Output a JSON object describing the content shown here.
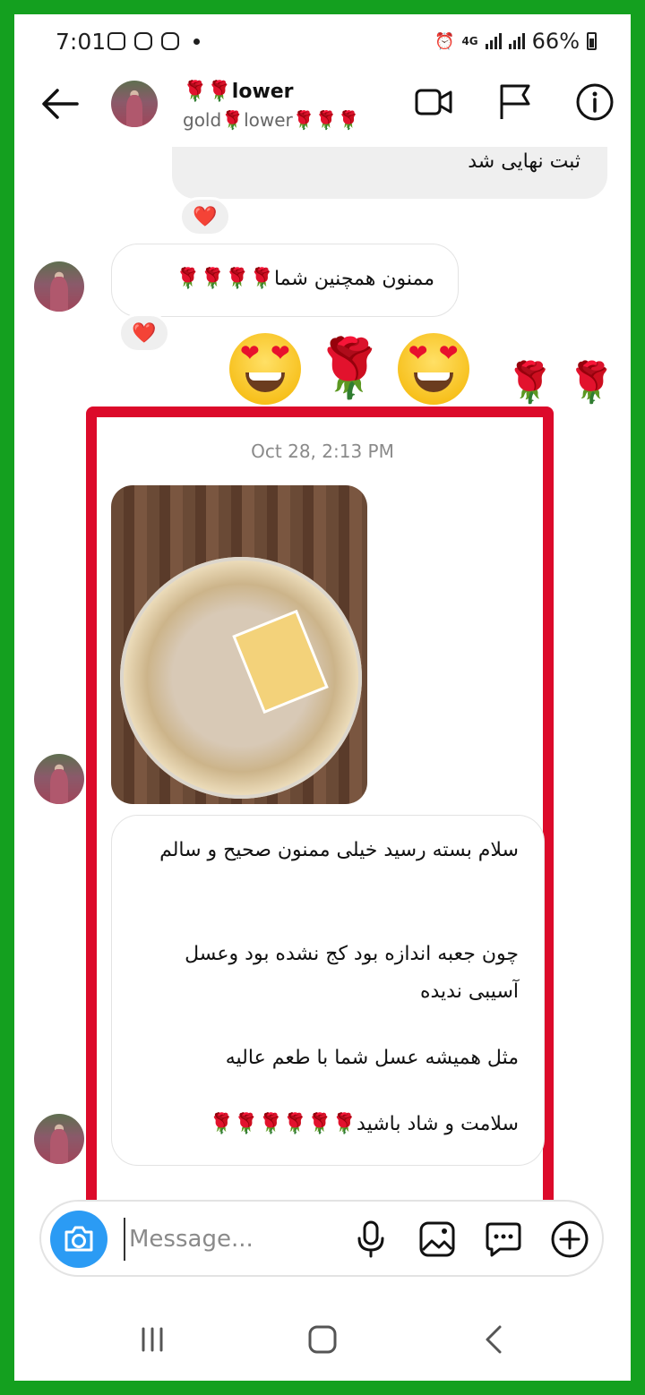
{
  "status_bar": {
    "time": "7:01",
    "network": "4G",
    "battery": "66%"
  },
  "header": {
    "name": "🌹🌹lower",
    "username": "gold🌹lower🌹🌹🌹"
  },
  "messages": [
    {
      "side": "out",
      "text": "ثبت نهایی شد",
      "reaction": "❤️"
    },
    {
      "side": "in",
      "text": "ممنون همچنین شما🌹🌹🌹🌹",
      "reaction": "❤️"
    },
    {
      "side": "in-emoji",
      "roses": "🌹 🌹"
    },
    {
      "side": "in",
      "timestamp": "Oct 28, 2:13 PM",
      "type": "photo"
    },
    {
      "side": "in",
      "paragraphs": [
        "سلام  بسته رسید خیلی ممنون صحیح و سالم",
        "چون جعبه اندازه بود کج نشده بود وعسل آسیبی ندیده",
        "مثل همیشه عسل شما با طعم عالیه",
        "سلامت و شاد باشید🌹🌹🌹🌹🌹🌹"
      ]
    }
  ],
  "composer": {
    "placeholder": "Message..."
  },
  "colors": {
    "frame": "#14a01f",
    "highlight": "#dc0a2a",
    "camera_button": "#2b9bf4",
    "heart": "#e8102d"
  }
}
